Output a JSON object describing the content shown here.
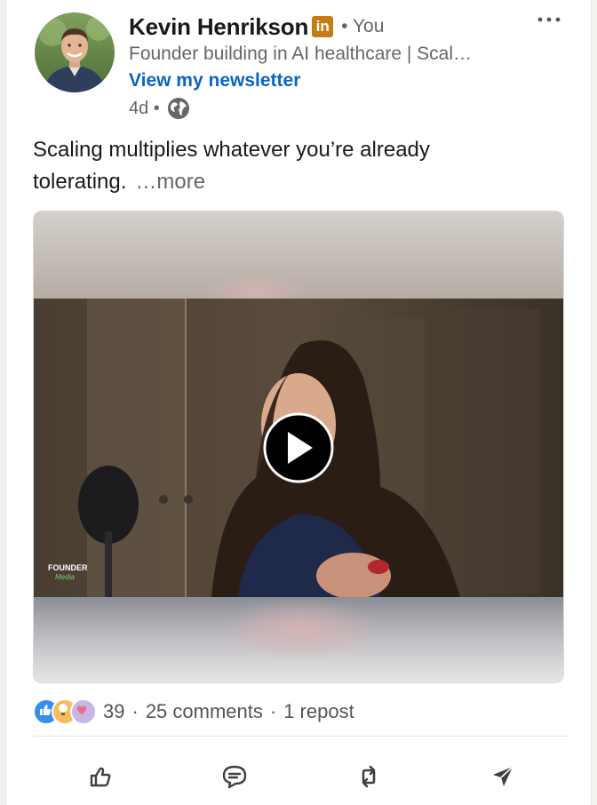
{
  "post": {
    "author": {
      "name": "Kevin Henrikson",
      "badge": "in",
      "relation": "• You",
      "headline": "Founder building in AI healthcare | Scal…",
      "newsletter_link": "View my newsletter"
    },
    "time": "4d •",
    "visibility_icon": "globe-icon",
    "text": "Scaling multiplies whatever you’re already tolerating.",
    "see_more": "…more",
    "video": {
      "watermark_line1": "FOUNDER",
      "watermark_line2": "Media",
      "play_icon": "play-icon"
    },
    "social": {
      "reaction_icons": [
        "like-icon",
        "insightful-icon",
        "support-icon"
      ],
      "reaction_count": "39",
      "sep1": "·",
      "comments": "25 comments",
      "sep2": "·",
      "reposts": "1 repost"
    },
    "actions": [
      {
        "name": "like",
        "icon": "thumbs-up-icon"
      },
      {
        "name": "comment",
        "icon": "comment-icon"
      },
      {
        "name": "repost",
        "icon": "repost-icon"
      },
      {
        "name": "send",
        "icon": "send-icon"
      }
    ]
  },
  "colors": {
    "link_blue": "#0a66c2",
    "muted_text": "#666666",
    "badge_gold": "#c37d16",
    "like_blue": "#378fe9"
  }
}
